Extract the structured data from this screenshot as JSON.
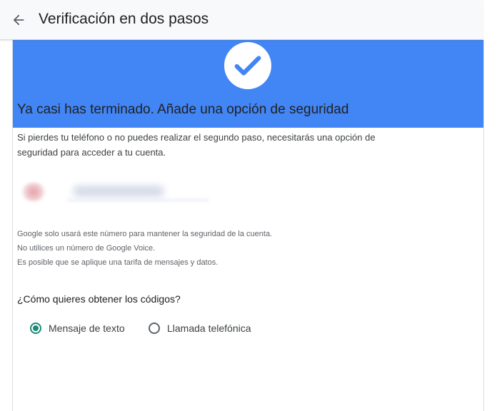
{
  "header": {
    "title": "Verificación en dos pasos",
    "back_icon": "arrow-back-icon"
  },
  "banner": {
    "color": "#4285f4",
    "icon": "check-icon"
  },
  "main": {
    "heading": "Ya casi has terminado. Añade una opción de seguridad",
    "description_line1": "Si pierdes tu teléfono o no puedes realizar el segundo paso, necesitarás una opción de",
    "description_line2": "seguridad para acceder a tu cuenta.",
    "notes": [
      "Google solo usará este número para mantener la seguridad de la cuenta.",
      "No utilices un número de Google Voice.",
      "Es posible que se aplique una tarifa de mensajes y datos."
    ],
    "question": "¿Cómo quieres obtener los códigos?",
    "options": [
      {
        "label": "Mensaje de texto",
        "checked": true
      },
      {
        "label": "Llamada telefónica",
        "checked": false
      }
    ],
    "accent_color": "#1a8c76"
  }
}
